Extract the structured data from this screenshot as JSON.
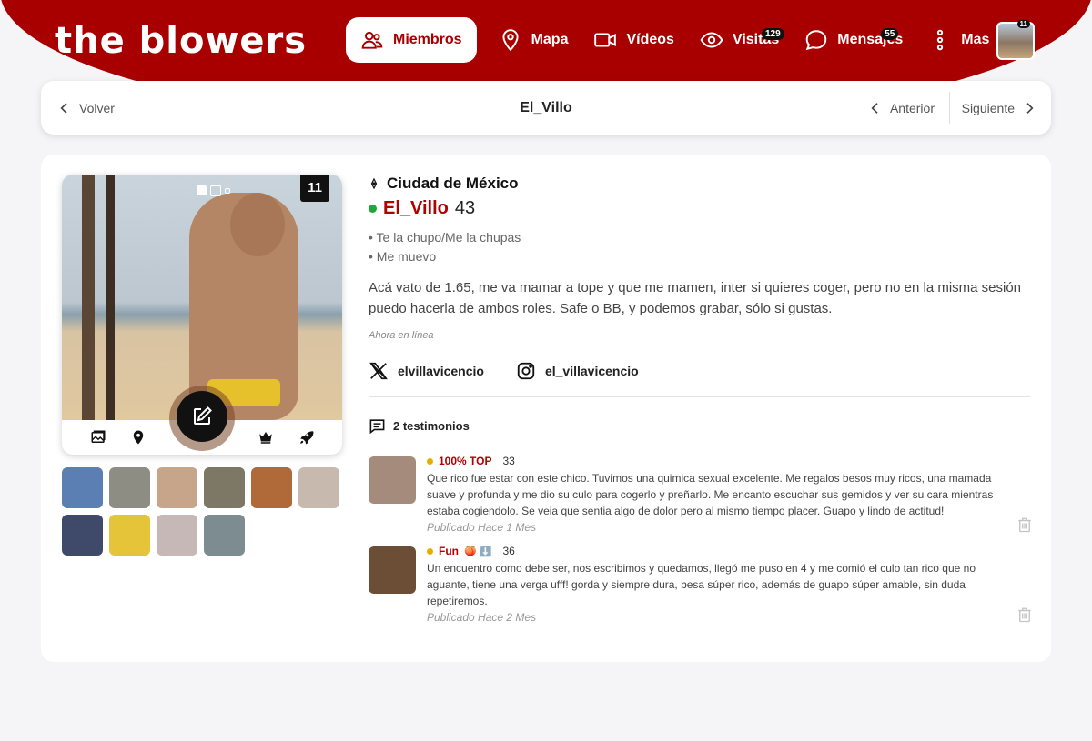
{
  "header": {
    "logo": "the blowers",
    "nav": [
      {
        "label": "Miembros",
        "icon": "members-icon",
        "active": true
      },
      {
        "label": "Mapa",
        "icon": "map-pin-icon"
      },
      {
        "label": "Vídeos",
        "icon": "video-icon"
      },
      {
        "label": "Visitas",
        "icon": "eye-icon",
        "badge": "129"
      },
      {
        "label": "Mensajes",
        "icon": "chat-bubble-icon",
        "badge": "55"
      },
      {
        "label": "Mas",
        "icon": "more-vertical-icon"
      }
    ],
    "avatar_badge": "11",
    "accent": "#a80000"
  },
  "subnav": {
    "back": "Volver",
    "title": "El_Villo",
    "prev": "Anterior",
    "next": "Siguiente"
  },
  "profile": {
    "photo_count": "11",
    "city": "Ciudad de México",
    "username": "El_Villo",
    "age": "43",
    "tags": [
      "Te la chupo/Me la chupas",
      "Me muevo"
    ],
    "bio": "Acá vato de 1.65, me va mamar a tope y que me mamen, inter si quieres coger, pero no en la misma sesión puedo hacerla de ambos roles. Safe o BB, y podemos grabar, sólo si gustas.",
    "status": "Ahora en línea",
    "twitter": "elvillavicencio",
    "instagram": "el_villavicencio",
    "thumb_colors": [
      "#5b7fb3",
      "#8d8d83",
      "#c6a58a",
      "#7d7766",
      "#b06a3a",
      "#c7b9ad",
      "#3f4a6a",
      "#e5c43a",
      "#c7b8b8",
      "#7c8c90"
    ]
  },
  "testimonials": {
    "heading": "2 testimonios",
    "items": [
      {
        "role": "100% TOP",
        "emoji": "",
        "age": "33",
        "text": "Que rico fue estar con este chico. Tuvimos una quimica sexual excelente. Me regalos besos muy ricos, una mamada suave y profunda y me dio su culo para cogerlo y preñarlo. Me encanto escuchar sus gemidos y ver su cara mientras estaba cogiendolo. Se veia que sentia algo de dolor pero al mismo tiempo placer. Guapo y lindo de actitud!",
        "date": "Publicado Hace 1 Mes",
        "img_color": "#a48b7b"
      },
      {
        "role": "Fun",
        "emoji": "🍑 ⬇️",
        "age": "36",
        "text": "Un encuentro como debe ser, nos escribimos y quedamos, llegó me puso en 4 y me comió el culo tan rico que no aguante, tiene una verga ufff! gorda y siempre dura, besa súper rico, además de guapo súper amable, sin duda repetiremos.",
        "date": "Publicado Hace 2 Mes",
        "img_color": "#6b4e35"
      }
    ]
  }
}
